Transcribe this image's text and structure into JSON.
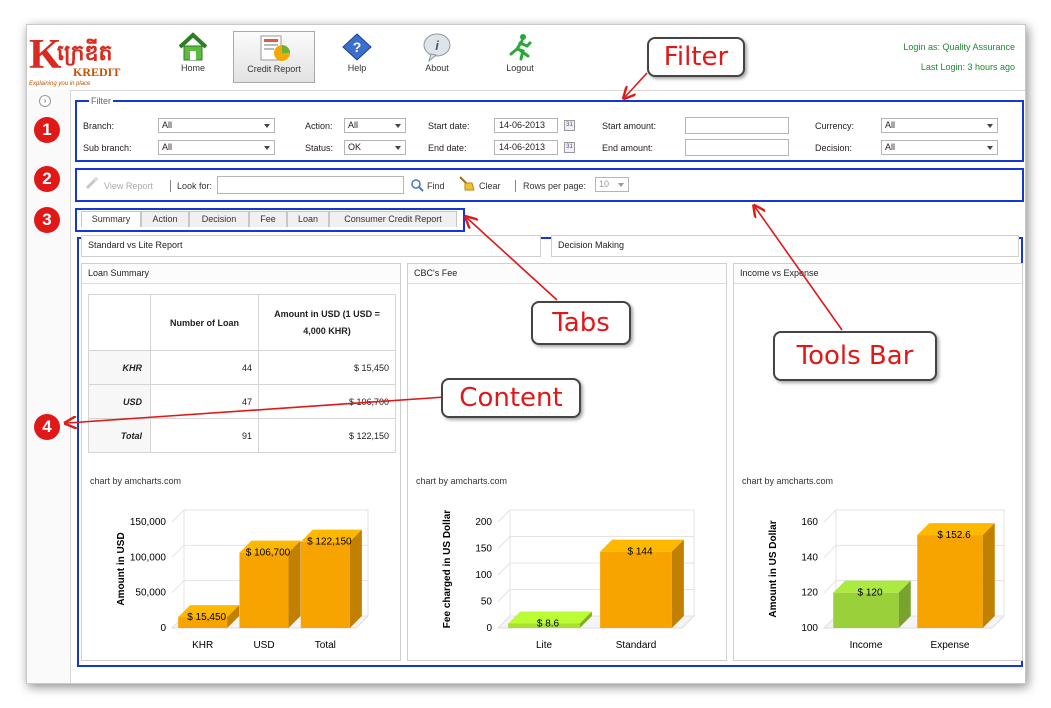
{
  "app": {
    "logo": {
      "mark": "K",
      "khmer": "ក្រេឌីត",
      "name": "KREDIT",
      "tagline": "Explaining you in place"
    },
    "nav": [
      {
        "label": "Home",
        "icon": "home-icon"
      },
      {
        "label": "Credit Report",
        "icon": "credit-report-icon"
      },
      {
        "label": "Help",
        "icon": "help-icon"
      },
      {
        "label": "About",
        "icon": "about-icon"
      },
      {
        "label": "Logout",
        "icon": "logout-icon"
      }
    ],
    "login_as": "Login as: Quality Assurance",
    "last_login": "Last Login: 3 hours ago"
  },
  "filter": {
    "legend": "Filter",
    "branch_label": "Branch:",
    "branch_value": "All",
    "subbranch_label": "Sub branch:",
    "subbranch_value": "All",
    "action_label": "Action:",
    "action_value": "All",
    "status_label": "Status:",
    "status_value": "OK",
    "start_date_label": "Start date:",
    "start_date_value": "14-06-2013",
    "end_date_label": "End date:",
    "end_date_value": "14-06-2013",
    "start_amount_label": "Start amount:",
    "start_amount_value": "",
    "end_amount_label": "End amount:",
    "end_amount_value": "",
    "currency_label": "Currency:",
    "currency_value": "All",
    "decision_label": "Decision:",
    "decision_value": "All",
    "calendar_glyph": "31"
  },
  "toolbar": {
    "view_report": "View Report",
    "look_for_label": "Look for:",
    "look_for_value": "",
    "find": "Find",
    "clear": "Clear",
    "rows_label": "Rows per page:",
    "rows_value": "10"
  },
  "tabs": [
    "Summary",
    "Action",
    "Decision",
    "Fee",
    "Loan",
    "Consumer Credit Report"
  ],
  "content": {
    "section_left": "Standard vs Lite Report",
    "section_right": "Decision Making",
    "loan_summary": {
      "title": "Loan Summary",
      "headers": [
        "",
        "Number of Loan",
        "Amount in USD (1 USD = 4,000 KHR)"
      ],
      "rows": [
        {
          "label": "KHR",
          "count": "44",
          "amount": "$ 15,450"
        },
        {
          "label": "USD",
          "count": "47",
          "amount": "$ 106,700"
        },
        {
          "label": "Total",
          "count": "91",
          "amount": "$ 122,150"
        }
      ]
    },
    "fee_title": "CBC's Fee",
    "income_title": "Income vs Expense",
    "chart_credit": "chart by amcharts.com"
  },
  "chart_data": [
    {
      "type": "bar",
      "categories": [
        "KHR",
        "USD",
        "Total"
      ],
      "values": [
        15450,
        106700,
        122150
      ],
      "data_labels": [
        "$ 15,450",
        "$ 106,700",
        "$ 122,150"
      ],
      "ylabel": "Amount in USD",
      "yticks": [
        "0",
        "50,000",
        "100,000",
        "150,000"
      ],
      "ylim": [
        0,
        150000
      ],
      "colors": [
        "#f7a400"
      ]
    },
    {
      "type": "bar",
      "categories": [
        "Lite",
        "Standard"
      ],
      "values": [
        8.6,
        144
      ],
      "data_labels": [
        "$ 8.6",
        "$ 144"
      ],
      "ylabel": "Fee charged in US Dollar",
      "yticks": [
        "0",
        "50",
        "100",
        "150",
        "200"
      ],
      "ylim": [
        0,
        200
      ],
      "colors": [
        "#a6e22e",
        "#f7a400"
      ]
    },
    {
      "type": "bar",
      "categories": [
        "Income",
        "Expense"
      ],
      "values": [
        120,
        152.6
      ],
      "data_labels": [
        "$ 120",
        "$ 152.6"
      ],
      "ylabel": "Amount in US Dollar",
      "yticks": [
        "100",
        "120",
        "140",
        "160"
      ],
      "ylim": [
        100,
        160
      ],
      "colors": [
        "#9ad13a",
        "#f7a400"
      ]
    }
  ],
  "annotations": {
    "filter": "Filter",
    "tools_bar": "Tools Bar",
    "tabs": "Tabs",
    "content": "Content",
    "numbers": [
      "1",
      "2",
      "3",
      "4"
    ]
  },
  "colors": {
    "highlight_border": "#1537d6",
    "annotation_red": "#e01818",
    "login_green": "#1f8a2e"
  }
}
